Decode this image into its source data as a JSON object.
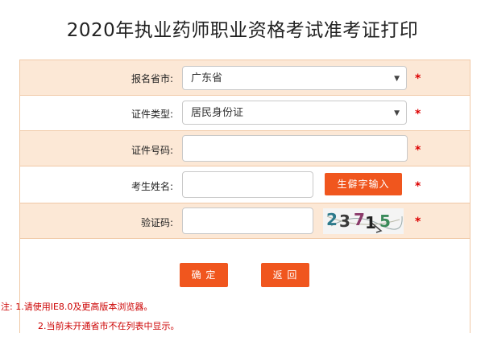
{
  "page": {
    "title": "2020年执业药师职业资格考试准考证打印"
  },
  "form": {
    "province": {
      "label": "报名省市:",
      "value": "广东省"
    },
    "id_type": {
      "label": "证件类型:",
      "value": "居民身份证"
    },
    "id_number": {
      "label": "证件号码:",
      "value": "",
      "placeholder": ""
    },
    "name": {
      "label": "考生姓名:",
      "value": "",
      "placeholder": "",
      "rare_char_button": "生僻字输入"
    },
    "captcha": {
      "label": "验证码:",
      "value": "",
      "placeholder": "",
      "image_text": "23715"
    },
    "required_mark": "*",
    "confirm_button": "确 定",
    "back_button": "返 回"
  },
  "notes": {
    "line1": "注: 1.请使用IE8.0及更高版本浏览器。",
    "line2": "2.当前未开通省市不在列表中显示。"
  },
  "colors": {
    "accent": "#f0561e",
    "row_alt": "#fce8d6",
    "border": "#f0c9a6",
    "required": "#dd0000"
  }
}
